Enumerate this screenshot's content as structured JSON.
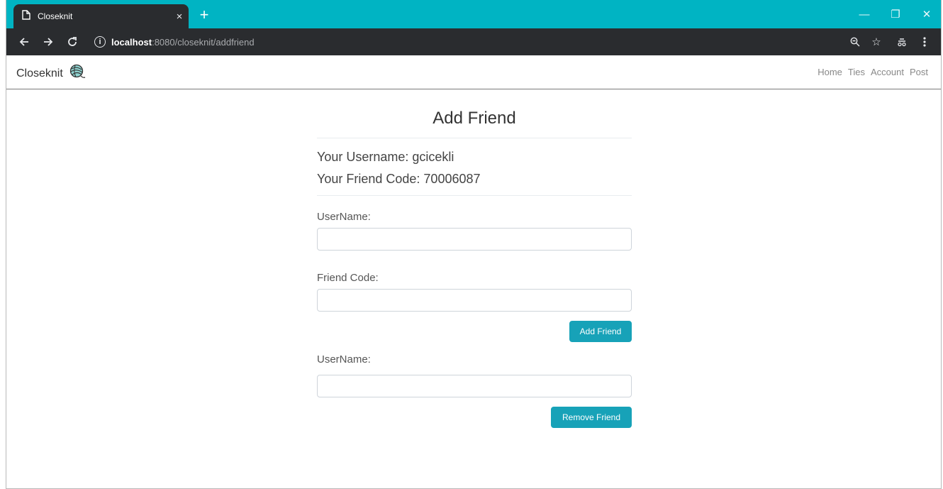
{
  "browser": {
    "tab_title": "Closeknit",
    "tab_close": "×",
    "new_tab": "+",
    "url_host": "localhost",
    "url_path": ":8080/closeknit/addfriend",
    "info_icon_glyph": "i",
    "window_controls": {
      "minimize": "—",
      "restore": "❐",
      "close": "✕"
    },
    "accent_color": "#00b4c3",
    "toolbar_color": "#2a2c2f"
  },
  "app": {
    "brand": "Closeknit",
    "nav": [
      "Home",
      "Ties",
      "Account",
      "Post"
    ]
  },
  "page": {
    "title": "Add Friend",
    "username_line": "Your Username: gcicekli",
    "friendcode_line": "Your Friend Code: 70006087",
    "add_form": {
      "username_label": "UserName:",
      "username_value": "",
      "friendcode_label": "Friend Code:",
      "friendcode_value": "",
      "submit_label": "Add Friend"
    },
    "remove_form": {
      "username_label": "UserName:",
      "username_value": "",
      "submit_label": "Remove Friend"
    },
    "button_color": "#17a2b8"
  }
}
